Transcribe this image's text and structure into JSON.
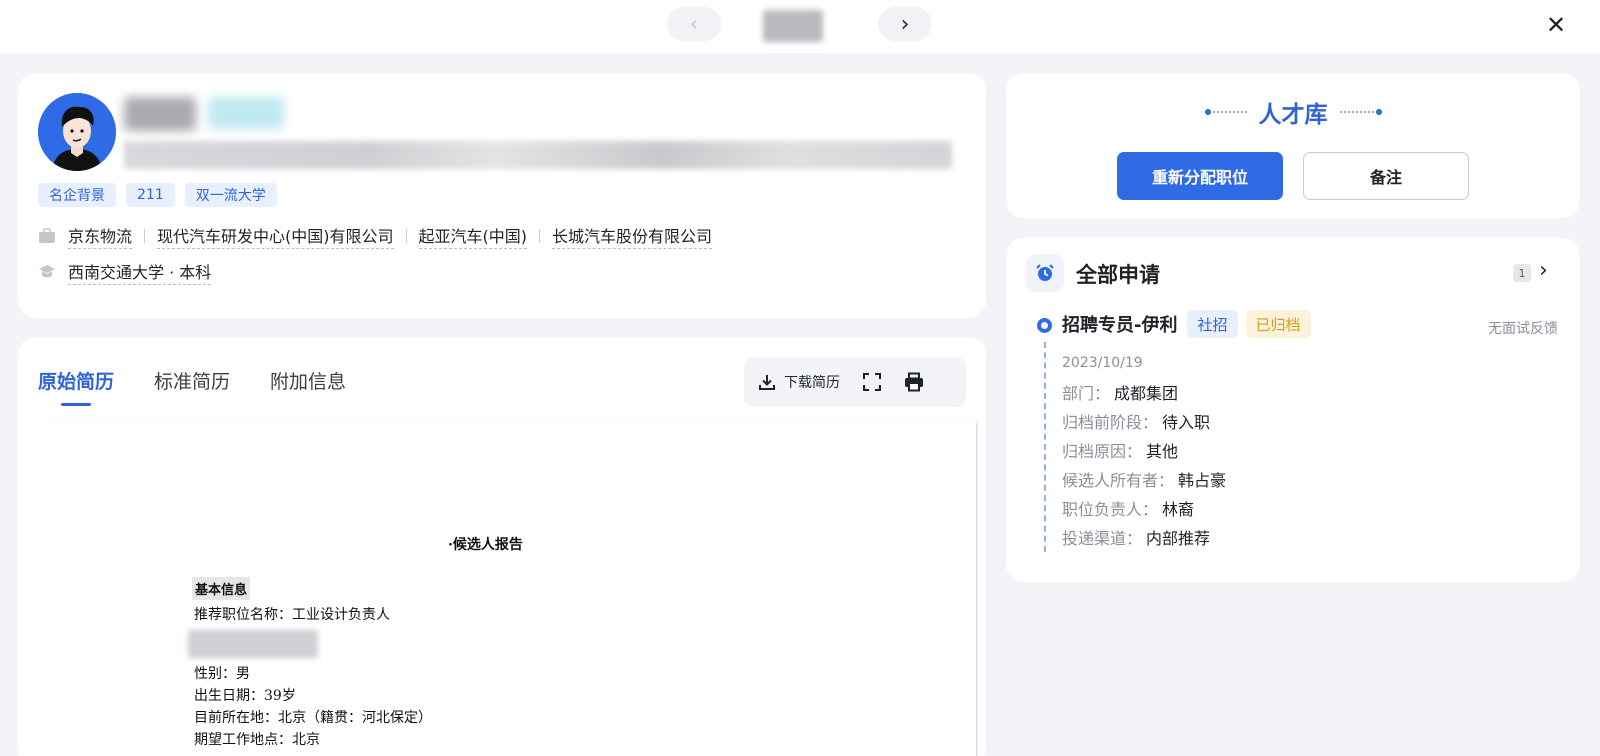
{
  "nav": {
    "prev_glyph": "‹",
    "next_glyph": "›",
    "close_glyph": "✕"
  },
  "profile": {
    "tags": [
      "名企背景",
      "211",
      "双一流大学"
    ],
    "work_history": [
      "京东物流",
      "现代汽车研发中心(中国)有限公司",
      "起亚汽车(中国)",
      "长城汽车股份有限公司"
    ],
    "education": "西南交通大学 · 本科",
    "icons": [
      "briefcase-icon",
      "graduation-cap-icon"
    ]
  },
  "resume": {
    "tabs": [
      {
        "label": "原始简历",
        "active": true
      },
      {
        "label": "标准简历",
        "active": false
      },
      {
        "label": "附加信息",
        "active": false
      }
    ],
    "toolbar": {
      "download_label": "下载简历",
      "icons": [
        "download-icon",
        "fullscreen-icon",
        "print-icon"
      ]
    },
    "document": {
      "title": "·候选人报告",
      "section": "基本信息",
      "recommended_position": "推荐职位名称：工业设计负责人",
      "lines": [
        "性别：男",
        "出生日期：39岁",
        "目前所在地：北京（籍贯：河北保定）",
        "期望工作地点：北京"
      ]
    }
  },
  "talent_pool": {
    "title": "人才库",
    "reassign_label": "重新分配职位",
    "note_label": "备注"
  },
  "applications": {
    "title": "全部申请",
    "count": "1",
    "item": {
      "position": "招聘专员-伊利",
      "badge_type": "社招",
      "badge_status": "已归档",
      "feedback": "无面试反馈",
      "date": "2023/10/19",
      "fields": [
        {
          "key": "部门：",
          "value": "成都集团"
        },
        {
          "key": "归档前阶段：",
          "value": "待入职"
        },
        {
          "key": "归档原因：",
          "value": "其他"
        },
        {
          "key": "候选人所有者：",
          "value": "韩占豪"
        },
        {
          "key": "职位负责人：",
          "value": "林裔"
        },
        {
          "key": "投递渠道：",
          "value": "内部推荐"
        }
      ]
    }
  },
  "colors": {
    "accent": "#2f6be6",
    "accent_text": "#2f63d8",
    "tag_bg": "#e8effd",
    "archived_bg": "#fdf3dc",
    "archived_text": "#d99a1a",
    "page_bg": "#f2f4f8"
  }
}
